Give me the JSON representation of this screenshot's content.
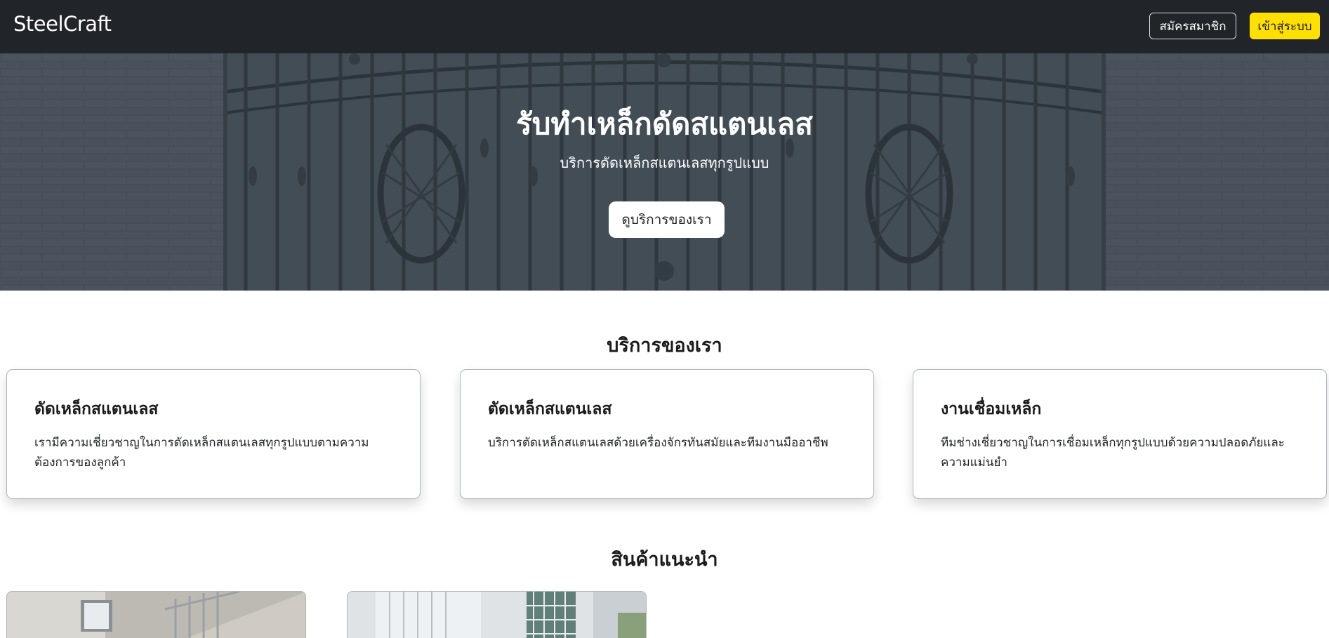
{
  "navbar": {
    "brand": "SteelCraft",
    "register_label": "สมัครสมาชิก",
    "login_label": "เข้าสู่ระบบ"
  },
  "hero": {
    "title": "รับทำเหล็กดัดสแตนเลส",
    "subtitle": "บริการดัดเหล็กสแตนเลสทุกรูปแบบ",
    "button_label": "ดูบริการของเรา"
  },
  "services": {
    "title": "บริการของเรา",
    "cards": [
      {
        "title": "ดัดเหล็กสแตนเลส",
        "text": "เรามีความเชี่ยวชาญในการดัดเหล็กสแตนเลสทุกรูปแบบตามความต้องการของลูกค้า"
      },
      {
        "title": "ตัดเหล็กสแตนเลส",
        "text": "บริการตัดเหล็กสแตนเลสด้วยเครื่องจักรทันสมัยและทีมงานมืออาชีพ"
      },
      {
        "title": "งานเชื่อมเหล็ก",
        "text": "ทีมช่างเชี่ยวชาญในการเชื่อมเหล็กทุกรูปแบบด้วยความปลอดภัยและความแม่นยำ"
      }
    ]
  },
  "products": {
    "title": "สินค้าแนะนำ"
  },
  "colors": {
    "navbar_bg": "#212529",
    "accent_yellow": "#ffe000",
    "hero_overlay": "#4a545d"
  }
}
